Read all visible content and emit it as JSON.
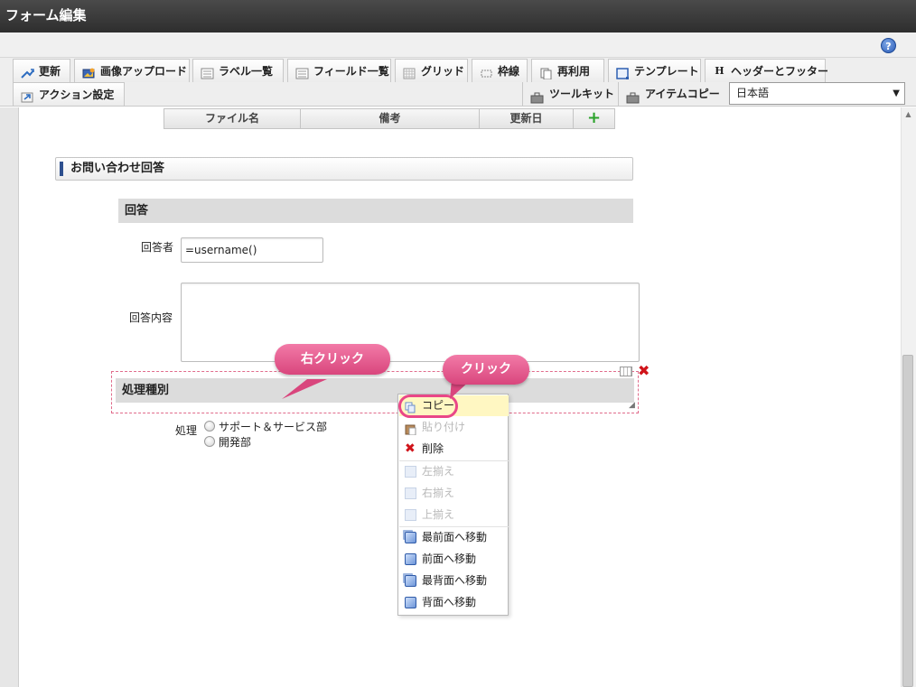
{
  "window": {
    "title": "フォーム編集"
  },
  "toolbar": {
    "row1": [
      {
        "label": "更新",
        "icon": "update-icon"
      },
      {
        "label": "画像アップロード",
        "icon": "image-upload-icon"
      },
      {
        "label": "ラベル一覧",
        "icon": "label-list-icon"
      },
      {
        "label": "フィールド一覧",
        "icon": "field-list-icon"
      },
      {
        "label": "グリッド",
        "icon": "grid-icon"
      },
      {
        "label": "枠線",
        "icon": "border-icon"
      },
      {
        "label": "再利用",
        "icon": "reuse-icon"
      },
      {
        "label": "テンプレート",
        "icon": "template-icon"
      },
      {
        "label": "ヘッダーとフッター",
        "icon": "header-footer-icon"
      }
    ],
    "row2": [
      {
        "label": "アクション設定",
        "icon": "action-settings-icon"
      },
      {
        "label": "ツールキット",
        "icon": "toolkit-icon"
      },
      {
        "label": "アイテムコピー",
        "icon": "item-copy-icon"
      }
    ],
    "language": {
      "selected": "日本語"
    },
    "help_symbol": "?"
  },
  "table": {
    "columns": [
      "ファイル名",
      "備考",
      "更新日"
    ],
    "add_symbol": "+"
  },
  "form": {
    "section_title": "お問い合わせ回答",
    "answer_header": "回答",
    "answerer_label": "回答者",
    "answerer_value": "=username()",
    "content_label": "回答内容",
    "content_value": "",
    "processing_header": "処理種別",
    "processing_label": "処理",
    "options": [
      "サポート＆サービス部",
      "開発部"
    ]
  },
  "context_menu": {
    "items": [
      {
        "label": "コピー",
        "enabled": true,
        "highlighted": true,
        "icon": "copy-icon"
      },
      {
        "label": "貼り付け",
        "enabled": false,
        "icon": "paste-icon"
      },
      {
        "label": "削除",
        "enabled": true,
        "icon": "delete-icon"
      },
      {
        "label": "左揃え",
        "enabled": false,
        "icon": "align-left-icon"
      },
      {
        "label": "右揃え",
        "enabled": false,
        "icon": "align-right-icon"
      },
      {
        "label": "上揃え",
        "enabled": false,
        "icon": "align-top-icon"
      },
      {
        "label": "最前面へ移動",
        "enabled": true,
        "icon": "bring-to-front-icon"
      },
      {
        "label": "前面へ移動",
        "enabled": true,
        "icon": "bring-forward-icon"
      },
      {
        "label": "最背面へ移動",
        "enabled": true,
        "icon": "send-to-back-icon"
      },
      {
        "label": "背面へ移動",
        "enabled": true,
        "icon": "send-backward-icon"
      }
    ]
  },
  "callouts": {
    "right_click": "右クリック",
    "click": "クリック"
  },
  "colors": {
    "accent_pink": "#e94788",
    "title_bar": "#3a3a3a",
    "highlight_yellow": "#fff7c2",
    "section_marker": "#2d4f8e",
    "delete_red": "#d0141a"
  }
}
